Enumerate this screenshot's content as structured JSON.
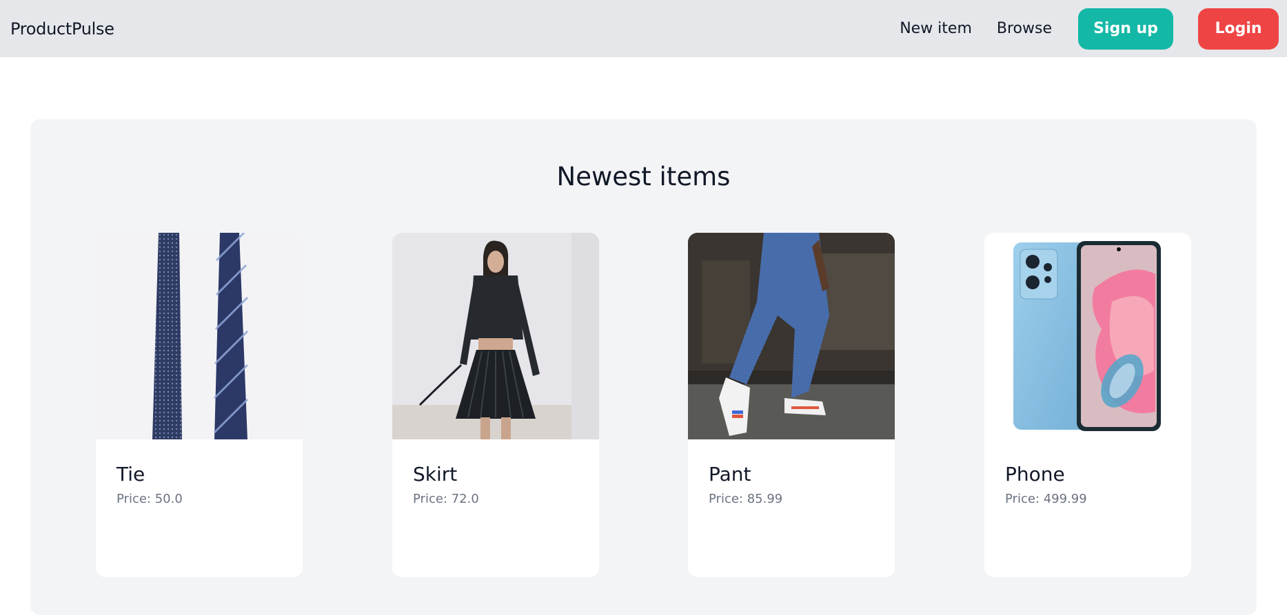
{
  "navbar": {
    "brand": "ProductPulse",
    "links": {
      "new_item": "New item",
      "browse": "Browse",
      "sign_up": "Sign up",
      "login": "Login"
    }
  },
  "main": {
    "title": "Newest items",
    "items": [
      {
        "name": "Tie",
        "price": "Price: 50.0",
        "image_icon": "tie-photo"
      },
      {
        "name": "Skirt",
        "price": "Price: 72.0",
        "image_icon": "skirt-photo"
      },
      {
        "name": "Pant",
        "price": "Price: 85.99",
        "image_icon": "pant-photo"
      },
      {
        "name": "Phone",
        "price": "Price: 499.99",
        "image_icon": "phone-photo"
      }
    ]
  },
  "colors": {
    "navbar_bg": "#e5e7eb",
    "signup_bg": "#14b8a6",
    "login_bg": "#ef4444",
    "panel_bg": "#f3f4f6",
    "price_text": "#6b7280"
  }
}
